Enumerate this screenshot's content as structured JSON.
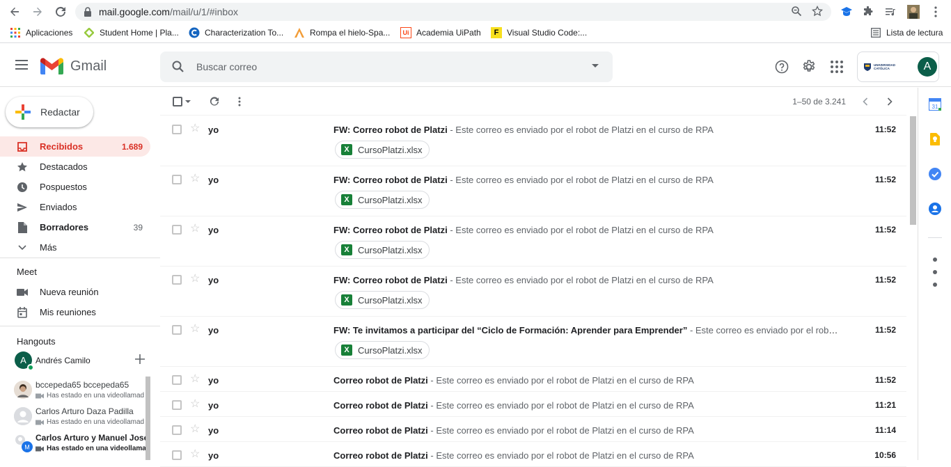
{
  "browser": {
    "url_host": "mail.google.com",
    "url_path": "/mail/u/1/#inbox",
    "bookmarks": [
      {
        "label": "Aplicaciones",
        "icon": "apps-grid-icon"
      },
      {
        "label": "Student Home | Pla...",
        "icon": "student-home-icon"
      },
      {
        "label": "Characterization To...",
        "icon": "characterization-icon"
      },
      {
        "label": "Rompa el hielo-Spa...",
        "icon": "rompa-hielo-icon"
      },
      {
        "label": "Academia UiPath",
        "icon": "uipath-icon"
      },
      {
        "label": "Visual Studio Code:...",
        "icon": "vscode-icon"
      }
    ],
    "reading_list": "Lista de lectura"
  },
  "header": {
    "app_name": "Gmail",
    "search_placeholder": "Buscar correo",
    "avatar_initial": "A",
    "org_logo_text": "UNIVERSIDAD CATÓLICA"
  },
  "sidebar": {
    "compose_label": "Redactar",
    "items": [
      {
        "label": "Recibidos",
        "count": "1.689",
        "icon": "inbox-icon"
      },
      {
        "label": "Destacados",
        "count": "",
        "icon": "star-icon"
      },
      {
        "label": "Pospuestos",
        "count": "",
        "icon": "clock-icon"
      },
      {
        "label": "Enviados",
        "count": "",
        "icon": "send-icon"
      },
      {
        "label": "Borradores",
        "count": "39",
        "icon": "draft-icon"
      },
      {
        "label": "Más",
        "count": "",
        "icon": "chevron-down-icon"
      }
    ],
    "meet": {
      "title": "Meet",
      "new_meeting": "Nueva reunión",
      "my_meetings": "Mis reuniones"
    },
    "hangouts": {
      "title": "Hangouts",
      "self_initial": "A",
      "self_name": "Andrés Camilo",
      "contacts": [
        {
          "name": "bccepeda65 bccepeda65",
          "status": "Has estado en una videollamad",
          "bold": false
        },
        {
          "name": "Carlos Arturo Daza Padilla",
          "status": "Has estado en una videollamad",
          "bold": false
        },
        {
          "name": "Carlos Arturo y Manuel Jose",
          "status": "Has estado en una videollama",
          "bold": true
        }
      ]
    }
  },
  "toolbar": {
    "pagination": "1–50 de 3.241"
  },
  "emails": [
    {
      "sender": "yo",
      "subject": "FW: Correo robot de Platzi",
      "snippet": " - Este correo es enviado por el robot de Platzi en el curso de RPA",
      "time": "11:52",
      "attachment": "CursoPlatzi.xlsx"
    },
    {
      "sender": "yo",
      "subject": "FW: Correo robot de Platzi",
      "snippet": " - Este correo es enviado por el robot de Platzi en el curso de RPA",
      "time": "11:52",
      "attachment": "CursoPlatzi.xlsx"
    },
    {
      "sender": "yo",
      "subject": "FW: Correo robot de Platzi",
      "snippet": " - Este correo es enviado por el robot de Platzi en el curso de RPA",
      "time": "11:52",
      "attachment": "CursoPlatzi.xlsx"
    },
    {
      "sender": "yo",
      "subject": "FW: Correo robot de Platzi",
      "snippet": " - Este correo es enviado por el robot de Platzi en el curso de RPA",
      "time": "11:52",
      "attachment": "CursoPlatzi.xlsx"
    },
    {
      "sender": "yo",
      "subject": "FW: Te invitamos a participar del “Ciclo de Formación: Aprender para Emprender”",
      "snippet": " - Este correo es enviado por el robot de P…",
      "time": "11:52",
      "attachment": "CursoPlatzi.xlsx"
    },
    {
      "sender": "yo",
      "subject": "Correo robot de Platzi",
      "snippet": " - Este correo es enviado por el robot de Platzi en el curso de RPA",
      "time": "11:52",
      "attachment": ""
    },
    {
      "sender": "yo",
      "subject": "Correo robot de Platzi",
      "snippet": " - Este correo es enviado por el robot de Platzi en el curso de RPA",
      "time": "11:21",
      "attachment": ""
    },
    {
      "sender": "yo",
      "subject": "Correo robot de Platzi",
      "snippet": " - Este correo es enviado por el robot de Platzi en el curso de RPA",
      "time": "11:14",
      "attachment": ""
    },
    {
      "sender": "yo",
      "subject": "Correo robot de Platzi",
      "snippet": " - Este correo es enviado por el robot de Platzi en el curso de RPA",
      "time": "10:56",
      "attachment": ""
    }
  ],
  "side_panel": [
    "calendar-icon",
    "keep-icon",
    "tasks-icon",
    "contacts-icon"
  ],
  "colors": {
    "accent": "#d93025",
    "active_bg": "#fce8e6",
    "excel": "#188038"
  }
}
